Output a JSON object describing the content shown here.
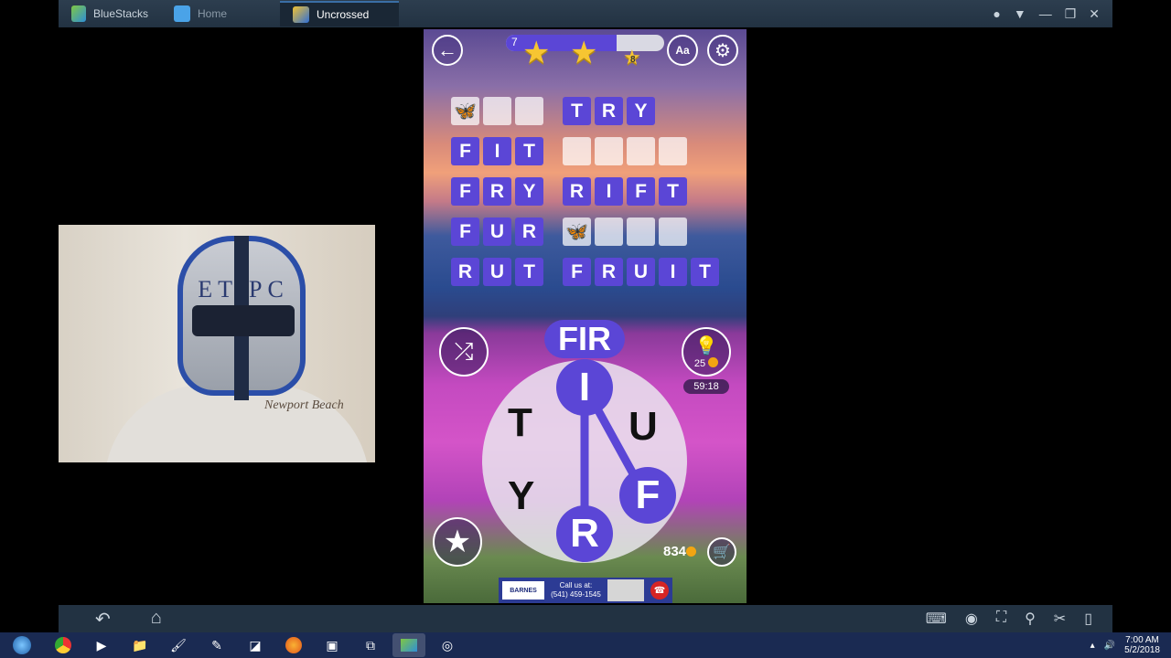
{
  "window": {
    "app_name": "BlueStacks",
    "tabs": [
      {
        "label": "Home"
      },
      {
        "label": "Uncrossed"
      }
    ]
  },
  "game": {
    "level_number": "7",
    "progress": 0.7,
    "star_count_badge": "8",
    "found_words": {
      "left": [
        {
          "letters": [
            "",
            "",
            ""
          ],
          "state": "empty",
          "hint": "butterfly-purple"
        },
        {
          "letters": [
            "F",
            "I",
            "T"
          ],
          "state": "filled"
        },
        {
          "letters": [
            "F",
            "R",
            "Y"
          ],
          "state": "filled"
        },
        {
          "letters": [
            "F",
            "U",
            "R"
          ],
          "state": "filled"
        },
        {
          "letters": [
            "R",
            "U",
            "T"
          ],
          "state": "filled"
        }
      ],
      "right": [
        {
          "letters": [
            "T",
            "R",
            "Y"
          ],
          "state": "filled"
        },
        {
          "letters": [
            "",
            "",
            "",
            ""
          ],
          "state": "empty"
        },
        {
          "letters": [
            "R",
            "I",
            "F",
            "T"
          ],
          "state": "filled"
        },
        {
          "letters": [
            "",
            "",
            "",
            ""
          ],
          "state": "empty",
          "hint": "butterfly-yellow"
        },
        {
          "letters": [
            "F",
            "R",
            "U",
            "I",
            "T"
          ],
          "state": "filled"
        }
      ]
    },
    "current_word": "FIR",
    "wheel_letters": {
      "i": "I",
      "t": "T",
      "u": "U",
      "y": "Y",
      "f": "F",
      "r": "R"
    },
    "hint_cost": "25",
    "timer": "59:18",
    "coins": "834",
    "ad": {
      "brand": "BARNES",
      "call_text": "Call us at:",
      "phone": "(541) 459-1545"
    }
  },
  "webcam": {
    "helmet_text": "ET PC",
    "shirt_text": "Newport Beach"
  },
  "taskbar": {
    "time": "7:00 AM",
    "date": "5/2/2018"
  },
  "colors": {
    "accent": "#5b46d6",
    "titlebar": "#2d3e4f",
    "taskbar": "#1a2a52"
  }
}
